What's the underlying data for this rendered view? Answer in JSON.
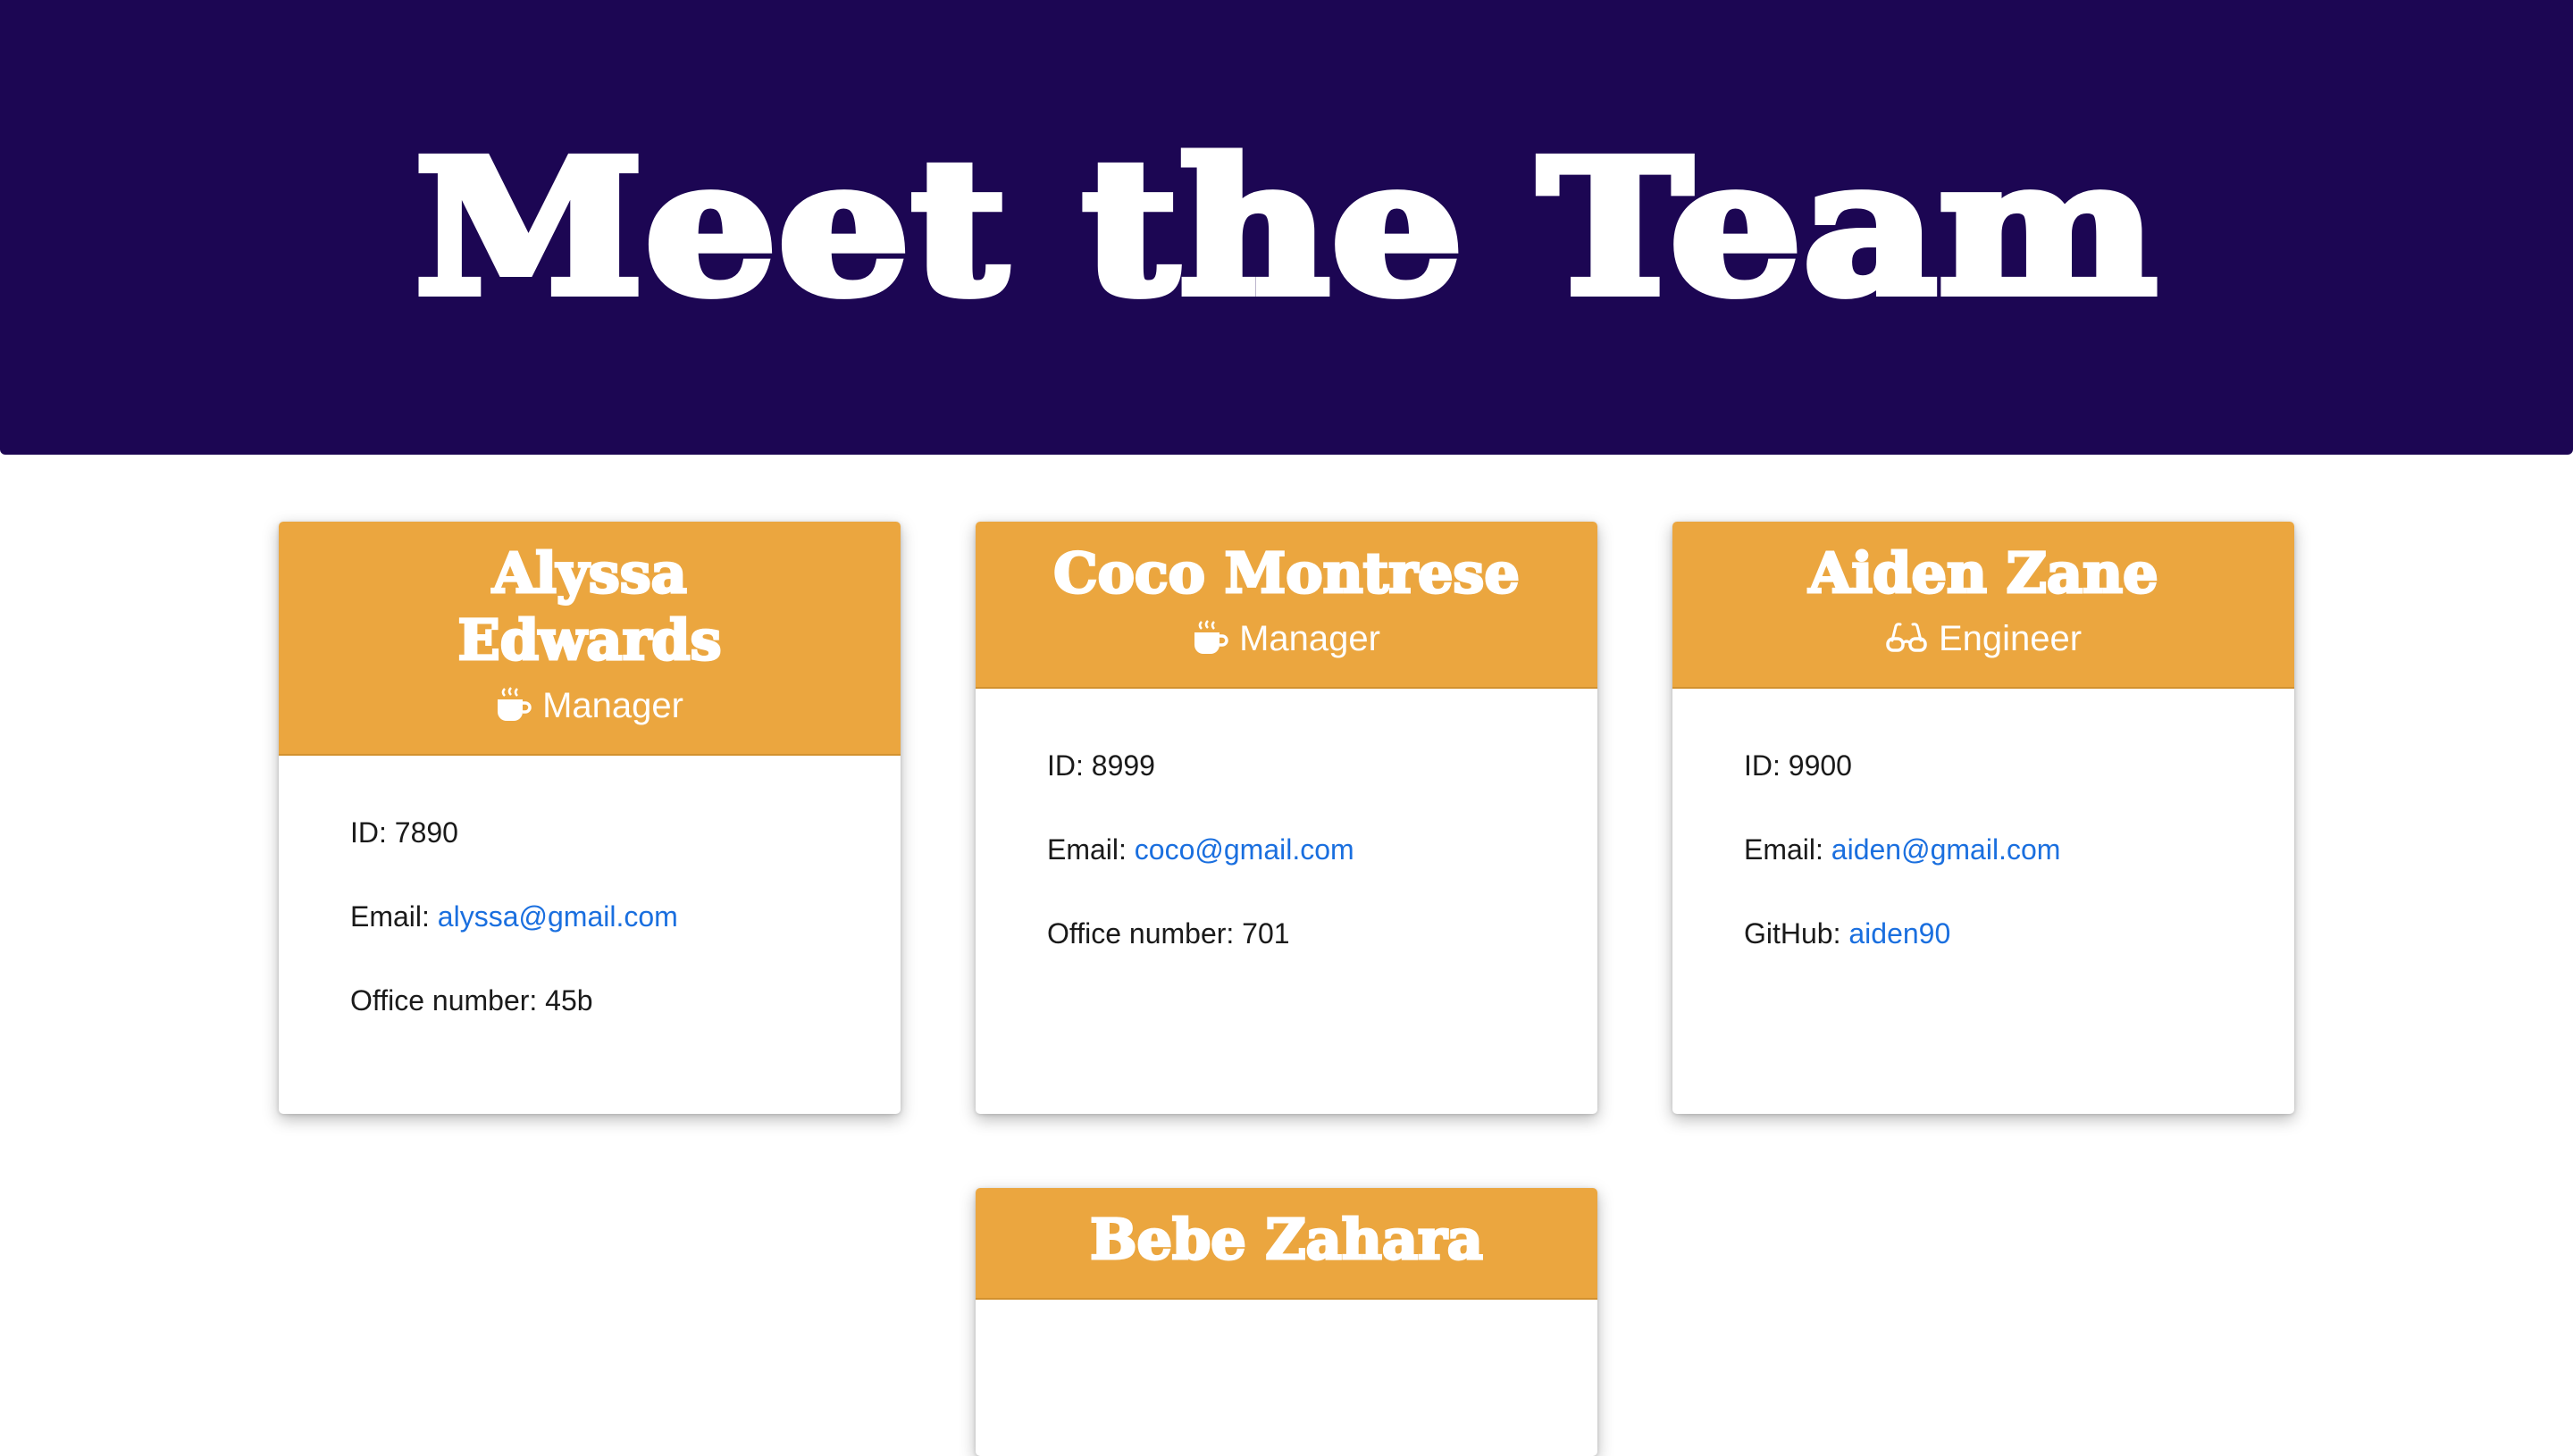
{
  "header": {
    "title": "Meet the Team"
  },
  "team": [
    {
      "name": "Alyssa Edwards",
      "role": "Manager",
      "role_icon": "coffee-icon",
      "id_label": "ID:",
      "id": "7890",
      "email_label": "Email:",
      "email": "alyssa@gmail.com",
      "extra_label": "Office number:",
      "extra": "45b"
    },
    {
      "name": "Coco Montrese",
      "role": "Manager",
      "role_icon": "coffee-icon",
      "id_label": "ID:",
      "id": "8999",
      "email_label": "Email:",
      "email": "coco@gmail.com",
      "extra_label": "Office number:",
      "extra": "701"
    },
    {
      "name": "Aiden Zane",
      "role": "Engineer",
      "role_icon": "glasses-icon",
      "id_label": "ID:",
      "id": "9900",
      "email_label": "Email:",
      "email": "aiden@gmail.com",
      "extra_label": "GitHub:",
      "extra": "aiden90"
    },
    {
      "name": "Bebe Zahara"
    }
  ],
  "colors": {
    "header_bg": "#1c0653",
    "card_header_bg": "#eba63f",
    "link": "#1a6fdf"
  }
}
